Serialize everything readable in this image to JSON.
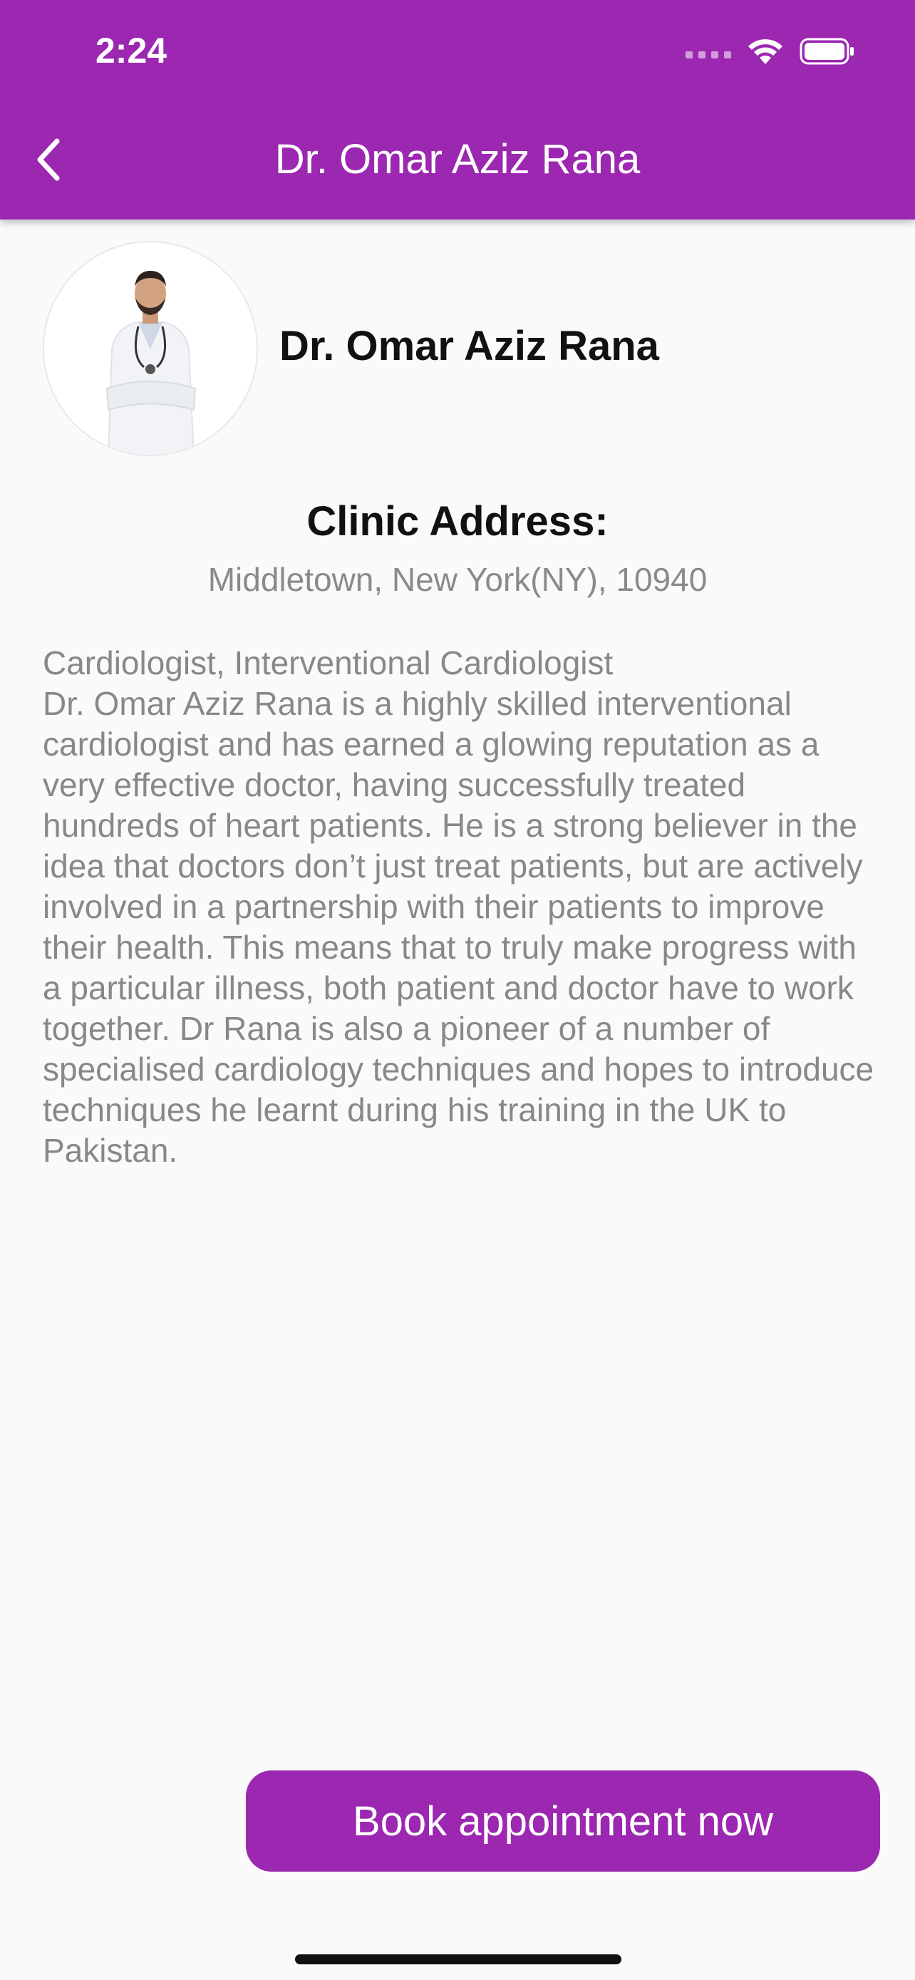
{
  "status_bar": {
    "time": "2:24"
  },
  "appbar": {
    "title": "Dr. Omar Aziz Rana",
    "back_icon": "chevron-left-icon"
  },
  "profile": {
    "name": "Dr. Omar Aziz Rana"
  },
  "clinic": {
    "title": "Clinic Address:",
    "address": "Middletown, New York(NY), 10940"
  },
  "bio": {
    "specialty": "Cardiologist, Interventional Cardiologist",
    "description": "Dr. Omar Aziz Rana is a highly skilled interventional cardiologist and has earned a glowing reputation as a very effective doctor, having successfully treated hundreds of heart patients. He is a strong believer in the idea that doctors don’t just treat patients, but are actively involved in a partnership with their patients to improve their health. This means that to truly make progress with a particular illness, both patient and doctor have to work together. Dr Rana is also a pioneer of a number of specialised cardiology techniques and hopes to introduce techniques he learnt during his training in the UK to Pakistan."
  },
  "actions": {
    "book_label": "Book appointment now"
  },
  "colors": {
    "primary": "#9c27b0",
    "background": "#fafafa",
    "text_muted": "#888888"
  }
}
